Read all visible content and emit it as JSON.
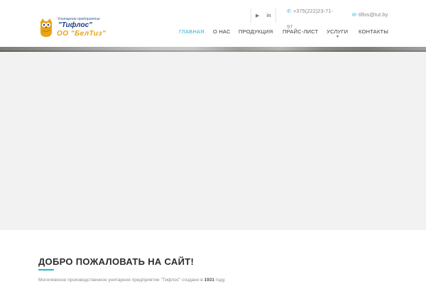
{
  "logo": {
    "line1": "Унитарное предприятие",
    "line2": "\"Тифлос\"",
    "line3": "ОО \"БелТиз\"",
    "icon": "owl-logo-icon",
    "colors": {
      "blue": "#1d3f8c",
      "gold": "#e8a317"
    }
  },
  "topbar": {
    "social": [
      "youtube-icon",
      "linkedin-icon"
    ],
    "social_glyphs": [
      "▶",
      "in"
    ],
    "phone_icon": "phone-icon",
    "phone": "+375(222)23-71-97",
    "email_icon": "mail-icon",
    "email": "tiflos@tut.by"
  },
  "nav": {
    "items": [
      {
        "label": "ГЛАВНАЯ",
        "active": true
      },
      {
        "label": "О НАС",
        "active": false
      },
      {
        "label": "ПРОДУКЦИЯ",
        "active": false
      },
      {
        "label": "ПРАЙС-ЛИСТ",
        "active": false
      },
      {
        "label": "УСЛУГИ",
        "active": false,
        "has_dropdown": true
      },
      {
        "label": "КОНТАКТЫ",
        "active": false
      }
    ],
    "dropdown_icon": "chevron-down-icon"
  },
  "welcome": {
    "title": "ДОБРО ПОЖАЛОВАТЬ НА САЙТ!",
    "text_before": "Могилевское производственное унитарное предприятие \"Тифлос\" создано в",
    "year": "1931",
    "text_after": "году."
  },
  "colors": {
    "accent": "#28b4cf",
    "nav_text": "#3c3c3c",
    "hero_bg": "#f2f2f2"
  }
}
